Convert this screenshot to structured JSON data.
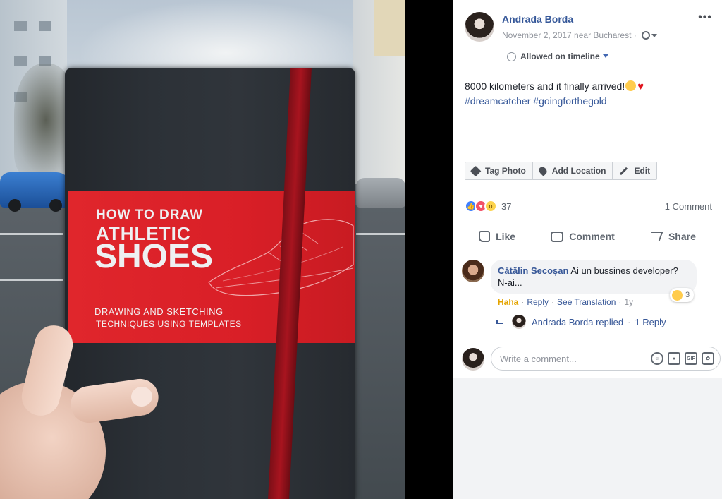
{
  "photo": {
    "book_title_line1": "HOW TO DRAW",
    "book_title_line2": "ATHLETIC",
    "book_title_line3": "SHOES",
    "book_subtitle_line1": "DRAWING AND SKETCHING",
    "book_subtitle_line2": "TECHNIQUES USING TEMPLATES"
  },
  "post": {
    "author": "Andrada Borda",
    "meta": "November 2, 2017 near Bucharest ·",
    "more": "•••",
    "allowed_label": "Allowed on timeline",
    "text": "8000 kilometers and it finally arrived!",
    "hashtag1": "#dreamcatcher",
    "hashtag2": "#goingforthegold",
    "buttons": {
      "tag_photo": "Tag Photo",
      "add_location": "Add Location",
      "edit": "Edit"
    },
    "reaction_count": "37",
    "comment_count": "1 Comment",
    "actions": {
      "like": "Like",
      "comment": "Comment",
      "share": "Share"
    }
  },
  "comments": {
    "first": {
      "author": "Cătălin Secoșan",
      "text": "Ai un bussines developer? N-ai...",
      "reaction_count": "3",
      "haha": "Haha",
      "reply": "Reply",
      "see_translation": "See Translation",
      "age": "1y"
    },
    "replies": {
      "replied_text": "Andrada Borda replied",
      "count_text": "1 Reply"
    },
    "write": {
      "placeholder": "Write a comment..."
    }
  },
  "colors": {
    "link": "#365899",
    "band_red": "#d91f27",
    "haha_yellow": "#e4a400"
  }
}
